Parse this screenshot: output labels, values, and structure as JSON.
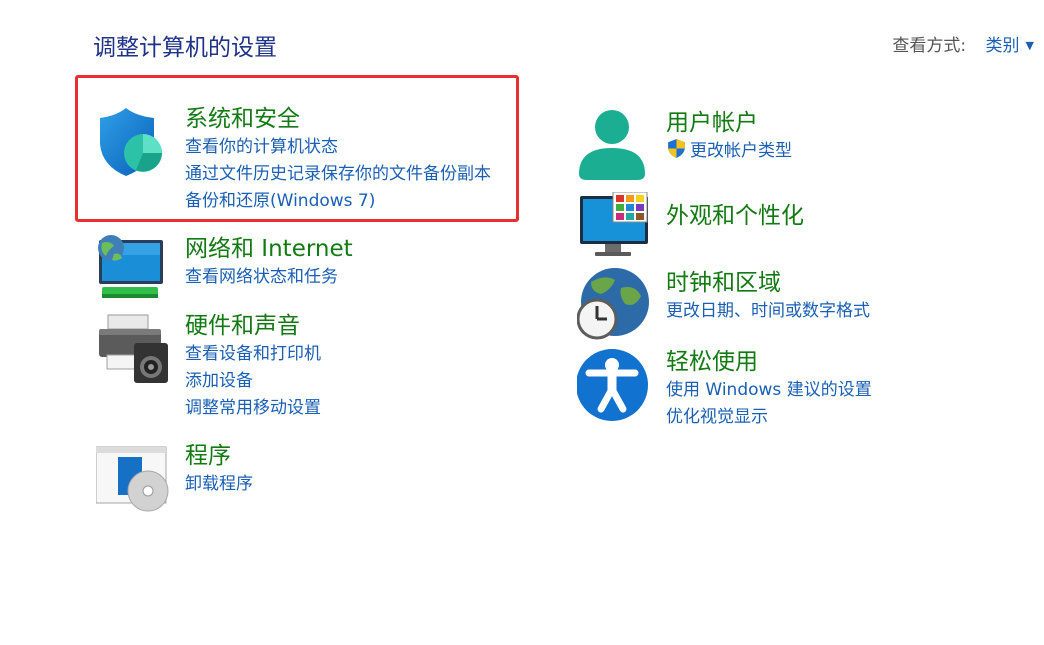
{
  "page": {
    "title": "调整计算机的设置"
  },
  "view_by": {
    "label": "查看方式:",
    "value": "类别"
  },
  "categories": {
    "system_security": {
      "title": "系统和安全",
      "links": [
        "查看你的计算机状态",
        "通过文件历史记录保存你的文件备份副本",
        "备份和还原(Windows 7)"
      ]
    },
    "network": {
      "title": "网络和 Internet",
      "links": [
        "查看网络状态和任务"
      ]
    },
    "hardware": {
      "title": "硬件和声音",
      "links": [
        "查看设备和打印机",
        "添加设备",
        "调整常用移动设置"
      ]
    },
    "programs": {
      "title": "程序",
      "links": [
        "卸载程序"
      ]
    },
    "user_accounts": {
      "title": "用户帐户",
      "links": [
        "更改帐户类型"
      ]
    },
    "appearance": {
      "title": "外观和个性化",
      "links": []
    },
    "clock_region": {
      "title": "时钟和区域",
      "links": [
        "更改日期、时间或数字格式"
      ]
    },
    "ease_of_access": {
      "title": "轻松使用",
      "links": [
        "使用 Windows 建议的设置",
        "优化视觉显示"
      ]
    }
  },
  "colors": {
    "title_blue": "#1e3287",
    "category_green": "#137a13",
    "link_blue": "#1a5fb4",
    "highlight_red": "#e8302e"
  }
}
